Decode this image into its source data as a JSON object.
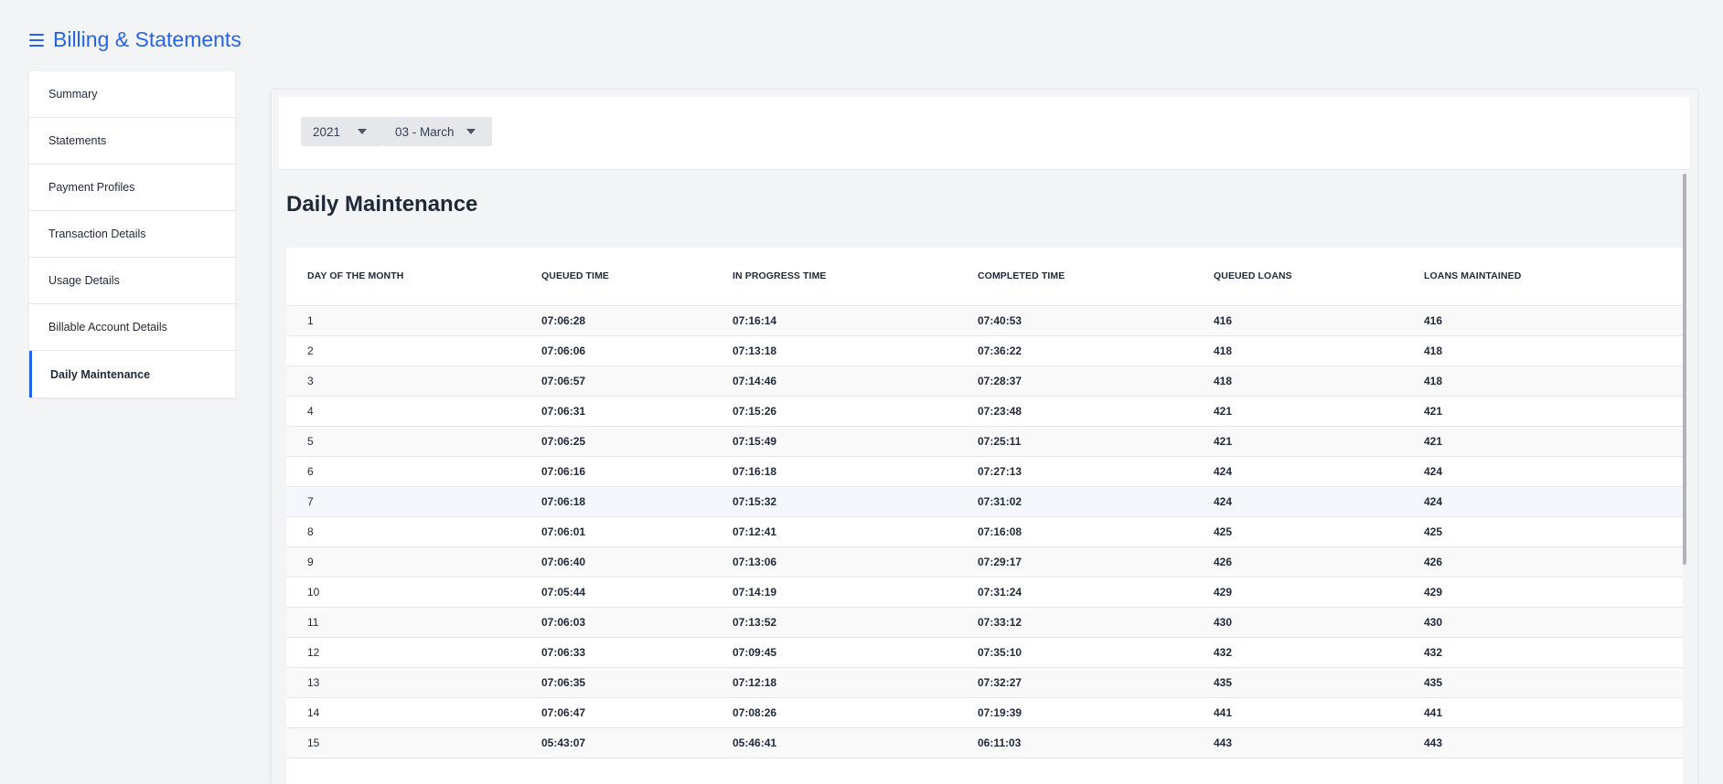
{
  "header": {
    "title": "Billing & Statements",
    "menu_icon": "hamburger-menu-icon"
  },
  "sidebar": {
    "items": [
      {
        "label": "Summary",
        "active": false
      },
      {
        "label": "Statements",
        "active": false
      },
      {
        "label": "Payment Profiles",
        "active": false
      },
      {
        "label": "Transaction Details",
        "active": false
      },
      {
        "label": "Usage Details",
        "active": false
      },
      {
        "label": "Billable Account Details",
        "active": false
      },
      {
        "label": "Daily Maintenance",
        "active": true
      }
    ]
  },
  "filters": {
    "year": "2021",
    "month": "03 - March"
  },
  "section": {
    "title": "Daily Maintenance"
  },
  "table": {
    "columns": [
      "DAY OF THE MONTH",
      "QUEUED TIME",
      "IN PROGRESS TIME",
      "COMPLETED TIME",
      "QUEUED LOANS",
      "LOANS MAINTAINED"
    ],
    "rows": [
      [
        "1",
        "07:06:28",
        "07:16:14",
        "07:40:53",
        "416",
        "416"
      ],
      [
        "2",
        "07:06:06",
        "07:13:18",
        "07:36:22",
        "418",
        "418"
      ],
      [
        "3",
        "07:06:57",
        "07:14:46",
        "07:28:37",
        "418",
        "418"
      ],
      [
        "4",
        "07:06:31",
        "07:15:26",
        "07:23:48",
        "421",
        "421"
      ],
      [
        "5",
        "07:06:25",
        "07:15:49",
        "07:25:11",
        "421",
        "421"
      ],
      [
        "6",
        "07:06:16",
        "07:16:18",
        "07:27:13",
        "424",
        "424"
      ],
      [
        "7",
        "07:06:18",
        "07:15:32",
        "07:31:02",
        "424",
        "424"
      ],
      [
        "8",
        "07:06:01",
        "07:12:41",
        "07:16:08",
        "425",
        "425"
      ],
      [
        "9",
        "07:06:40",
        "07:13:06",
        "07:29:17",
        "426",
        "426"
      ],
      [
        "10",
        "07:05:44",
        "07:14:19",
        "07:31:24",
        "429",
        "429"
      ],
      [
        "11",
        "07:06:03",
        "07:13:52",
        "07:33:12",
        "430",
        "430"
      ],
      [
        "12",
        "07:06:33",
        "07:09:45",
        "07:35:10",
        "432",
        "432"
      ],
      [
        "13",
        "07:06:35",
        "07:12:18",
        "07:32:27",
        "435",
        "435"
      ],
      [
        "14",
        "07:06:47",
        "07:08:26",
        "07:19:39",
        "441",
        "441"
      ],
      [
        "15",
        "05:43:07",
        "05:46:41",
        "06:11:03",
        "443",
        "443"
      ]
    ]
  }
}
